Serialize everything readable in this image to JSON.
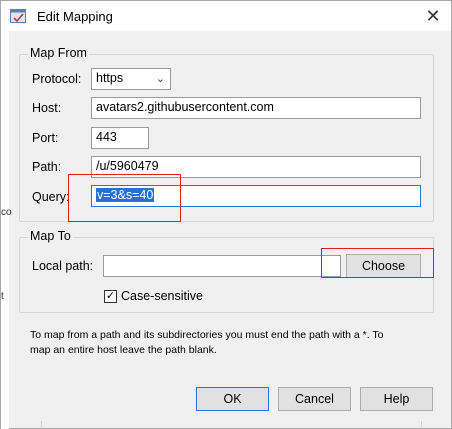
{
  "window": {
    "title": "Edit Mapping",
    "close_glyph": "✕"
  },
  "left_strip": {
    "letter_top": "co",
    "letter_bottom": "t"
  },
  "map_from": {
    "title": "Map From",
    "protocol_label": "Protocol:",
    "protocol_value": "https",
    "host_label": "Host:",
    "host_value": "avatars2.githubusercontent.com",
    "port_label": "Port:",
    "port_value": "443",
    "path_label": "Path:",
    "path_value": "/u/5960479",
    "query_label": "Query:",
    "query_value": "v=3&s=40"
  },
  "map_to": {
    "title": "Map To",
    "local_path_label": "Local path:",
    "local_path_value": "",
    "choose_label": "Choose",
    "case_sensitive_label": "Case-sensitive",
    "case_sensitive_checked": true
  },
  "hint": {
    "line1": "To map from a path and its subdirectories you must end the path with a *. To",
    "line2": "map an entire host leave the path blank."
  },
  "buttons": {
    "ok": "OK",
    "cancel": "Cancel",
    "help": "Help"
  },
  "colors": {
    "highlight": "#e02020",
    "selection": "#2a6fd6",
    "focus": "#2f77d6"
  }
}
